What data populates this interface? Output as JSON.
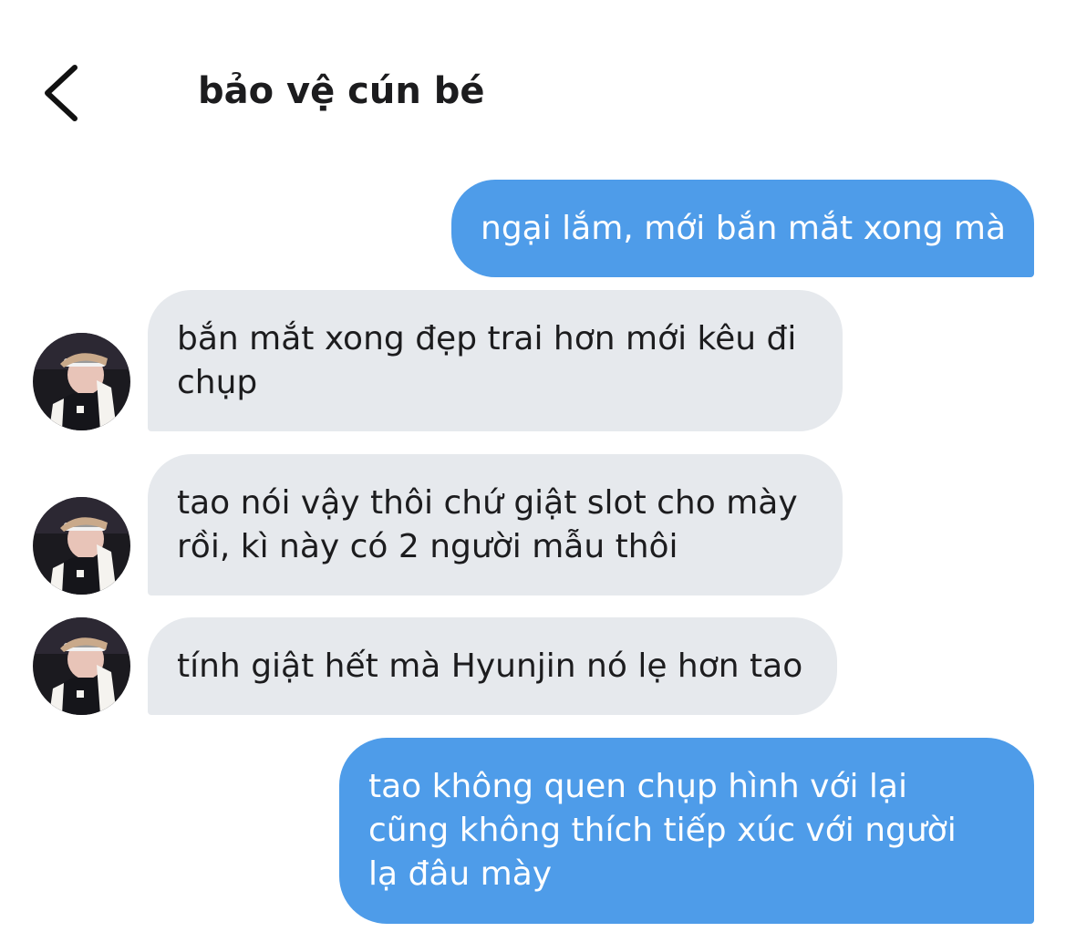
{
  "conversation": {
    "title": "bảo vệ cún bé",
    "back_icon": "chevron-left-icon"
  },
  "colors": {
    "outgoing_bubble": "#4e9ce9",
    "incoming_bubble": "#e6e9ed",
    "background": "#ffffff",
    "text_dark": "#1c1c1e"
  },
  "messages": [
    {
      "sender": "me",
      "lines": [
        "ngại lắm, mới bắn mắt xong mà"
      ]
    },
    {
      "sender": "other",
      "lines": [
        "bắn mắt xong đẹp trai hơn mới kêu đi",
        "chụp"
      ]
    },
    {
      "sender": "other",
      "lines": [
        "tao nói vậy thôi chứ giật slot cho mày",
        "rồi, kì này có 2 người mẫu thôi"
      ]
    },
    {
      "sender": "other",
      "lines": [
        "tính giật hết mà Hyunjin nó lẹ hơn tao"
      ]
    },
    {
      "sender": "me",
      "lines": [
        "tao không quen chụp hình với lại",
        "cũng không thích tiếp xúc với người",
        "lạ đâu mày"
      ]
    }
  ]
}
